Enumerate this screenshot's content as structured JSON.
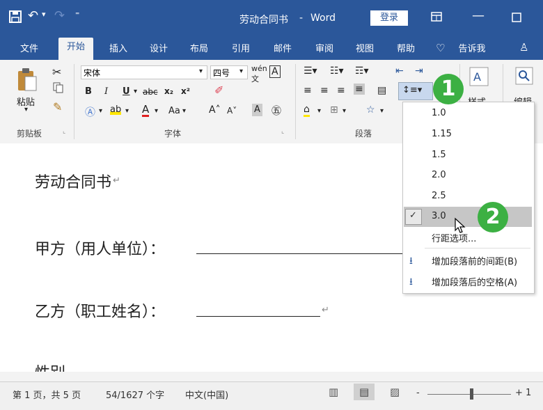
{
  "title_bar": {
    "doc_title": "劳动合同书",
    "separator": "-",
    "app_name": "Word",
    "login_button": "登录"
  },
  "ribbon_tabs": [
    "文件",
    "开始",
    "插入",
    "设计",
    "布局",
    "引用",
    "邮件",
    "审阅",
    "视图",
    "帮助",
    "告诉我"
  ],
  "clipboard": {
    "paste_label": "粘贴",
    "group_label": "剪贴板"
  },
  "font": {
    "font_name": "宋体",
    "font_size": "四号",
    "group_label": "字体",
    "aa_label": "Aa"
  },
  "paragraph": {
    "group_label": "段落"
  },
  "styles": {
    "label": "样式"
  },
  "editing": {
    "label": "编辑"
  },
  "document": {
    "lines": [
      "劳动合同书",
      "甲方（用人单位）：",
      "乙方（职工姓名）：",
      "性别"
    ]
  },
  "line_spacing_menu": {
    "options": [
      "1.0",
      "1.15",
      "1.5",
      "2.0",
      "2.5",
      "3.0"
    ],
    "selected": "3.0",
    "more_options": "行距选项...",
    "add_before": "增加段落前的间距(B)",
    "add_after": "增加段落后的空格(A)"
  },
  "badges": [
    "1",
    "2"
  ],
  "status_bar": {
    "page": "第 1 页，共 5 页",
    "words": "54/1627 个字",
    "language": "中文(中国)",
    "zoom_minus": "-",
    "zoom_plus": "+ 1"
  },
  "colors": {
    "accent": "#2b579a",
    "badge": "#3cb043"
  }
}
